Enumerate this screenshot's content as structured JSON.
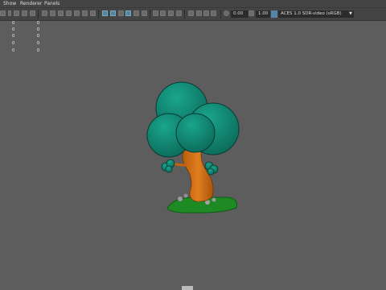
{
  "menu": [
    "Show",
    "Renderer",
    "Panels"
  ],
  "toolbar": {
    "value_a": "0.00",
    "value_b": "1.00",
    "color_space": "ACES 1.0 SDR-video (sRGB)"
  },
  "hud": {
    "rows": [
      {
        "left": "0",
        "right": "0"
      },
      {
        "left": "0",
        "right": "0"
      },
      {
        "left": "0",
        "right": "0"
      },
      {
        "left": "0",
        "right": "0"
      },
      {
        "left": "0",
        "right": "0"
      }
    ]
  },
  "colors": {
    "foliage": "#138b76",
    "trunk": "#d87418",
    "grass": "#1e8a23",
    "background": "#5d5d5d"
  }
}
